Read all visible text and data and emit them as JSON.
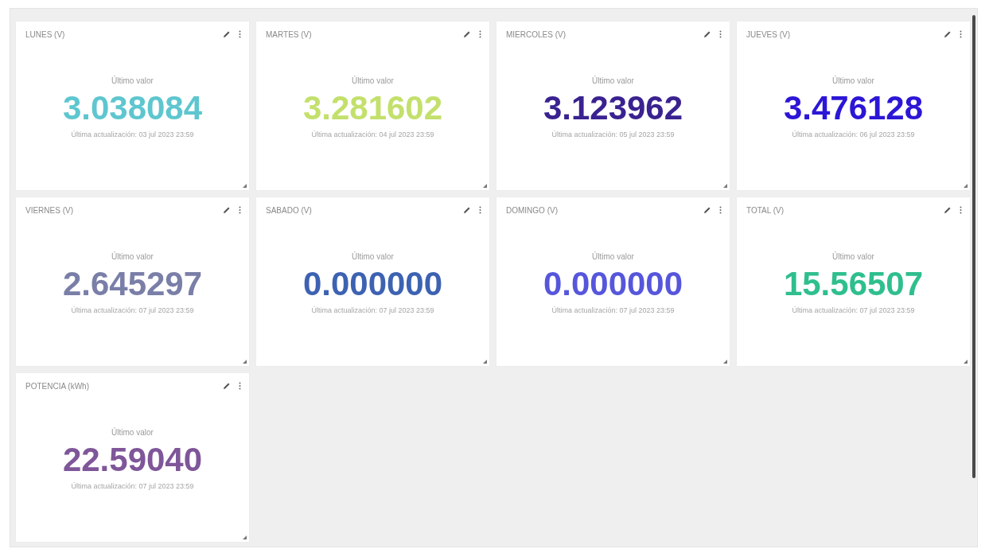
{
  "widgets": [
    {
      "title": "LUNES (V)",
      "label": "Último valor",
      "value": "3.038084",
      "color": "#5ec6cf",
      "updated": "Última actualización: 03 jul 2023 23:59"
    },
    {
      "title": "MARTES (V)",
      "label": "Último valor",
      "value": "3.281602",
      "color": "#c3e06c",
      "updated": "Última actualización: 04 jul 2023 23:59"
    },
    {
      "title": "MIERCOLES (V)",
      "label": "Último valor",
      "value": "3.123962",
      "color": "#3a2290",
      "updated": "Última actualización: 05 jul 2023 23:59"
    },
    {
      "title": "JUEVES (V)",
      "label": "Último valor",
      "value": "3.476128",
      "color": "#2c16d6",
      "updated": "Última actualización: 06 jul 2023 23:59"
    },
    {
      "title": "VIERNES (V)",
      "label": "Último valor",
      "value": "2.645297",
      "color": "#7a7fa8",
      "updated": "Última actualización: 07 jul 2023 23:59"
    },
    {
      "title": "SABADO (V)",
      "label": "Último valor",
      "value": "0.000000",
      "color": "#3d62b2",
      "updated": "Última actualización: 07 jul 2023 23:59"
    },
    {
      "title": "DOMINGO (V)",
      "label": "Último valor",
      "value": "0.000000",
      "color": "#5656dc",
      "updated": "Última actualización: 07 jul 2023 23:59"
    },
    {
      "title": "TOTAL (V)",
      "label": "Último valor",
      "value": "15.56507",
      "color": "#2fbf8c",
      "updated": "Última actualización: 07 jul 2023 23:59"
    },
    {
      "title": "POTENCIA (kWh)",
      "label": "Último valor",
      "value": "22.59040",
      "color": "#7e5699",
      "updated": "Última actualización: 07 jul 2023 23:59"
    }
  ]
}
